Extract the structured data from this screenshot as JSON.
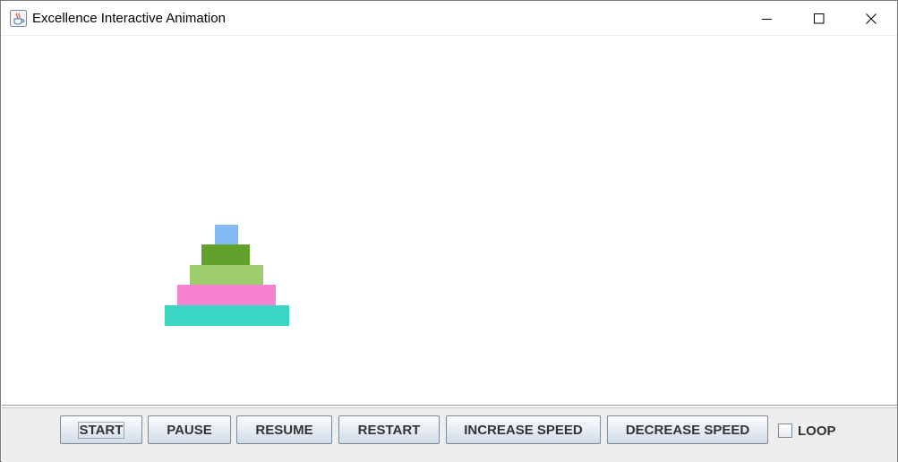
{
  "window": {
    "title": "Excellence Interactive Animation",
    "app_icon": "java-coffee-icon",
    "controls": {
      "minimize_icon": "minimize-icon",
      "maximize_icon": "maximize-icon",
      "close_icon": "close-icon"
    }
  },
  "animation": {
    "disks": [
      {
        "color": "#83baf3"
      },
      {
        "color": "#62a22c"
      },
      {
        "color": "#9dcc6e"
      },
      {
        "color": "#f882d2"
      },
      {
        "color": "#39d6c4"
      }
    ]
  },
  "controls": {
    "start_label": "START",
    "pause_label": "PAUSE",
    "resume_label": "RESUME",
    "restart_label": "RESTART",
    "increase_speed_label": "INCREASE SPEED",
    "decrease_speed_label": "DECREASE SPEED",
    "loop_label": "LOOP",
    "loop_checked": false
  }
}
